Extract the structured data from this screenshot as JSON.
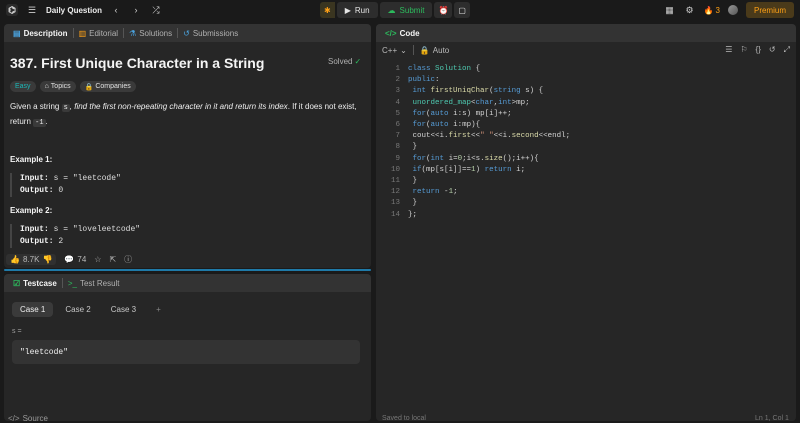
{
  "topbar": {
    "title": "Daily Question",
    "run": "Run",
    "submit": "Submit",
    "streak": "3",
    "premium": "Premium"
  },
  "desc_tabs": [
    "Description",
    "Editorial",
    "Solutions",
    "Submissions"
  ],
  "problem": {
    "title": "387. First Unique Character in a String",
    "status": "Solved",
    "difficulty": "Easy",
    "topics": "Topics",
    "companies": "Companies",
    "text_a": "Given a string ",
    "text_var": "s",
    "text_b": ", find the first non-repeating character in it and return its index",
    "text_c": ". If it does not exist, return ",
    "text_neg": "-1",
    "text_d": ".",
    "examples": [
      {
        "title": "Example 1:",
        "input_label": "Input:",
        "input": "s = \"leetcode\"",
        "output_label": "Output:",
        "output": "0"
      },
      {
        "title": "Example 2:",
        "input_label": "Input:",
        "input": "s = \"loveleetcode\"",
        "output_label": "Output:",
        "output": "2"
      }
    ],
    "likes": "8.7K",
    "comments": "74"
  },
  "testcase": {
    "tab_testcase": "Testcase",
    "tab_result": "Test Result",
    "cases": [
      "Case 1",
      "Case 2",
      "Case 3"
    ],
    "add": "+",
    "label": "s =",
    "value": "\"leetcode\"",
    "source": "Source"
  },
  "code": {
    "tab": "Code",
    "language": "C++",
    "auto": "Auto",
    "saved": "Saved to local",
    "position": "Ln 1, Col 1"
  },
  "colors": {
    "accent": "#ffa116",
    "green": "#2cbb5d",
    "easy": "#1cb8b8"
  }
}
